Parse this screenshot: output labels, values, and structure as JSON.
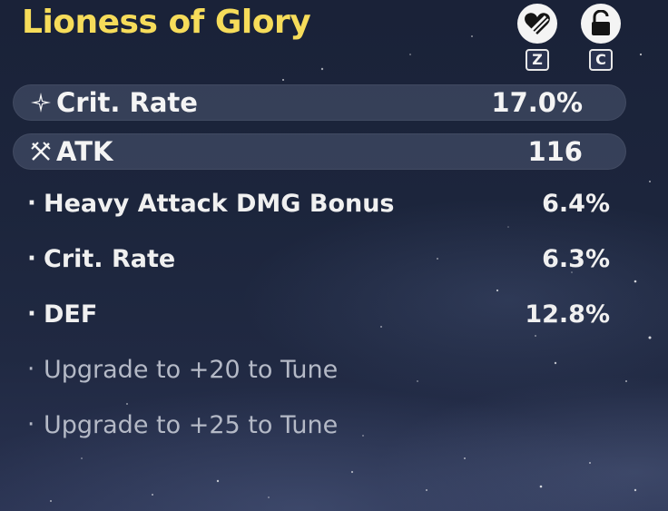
{
  "item": {
    "title": "Lioness of Glory"
  },
  "actions": [
    {
      "icon": "heart-icon",
      "key": "Z"
    },
    {
      "icon": "lock-icon",
      "key": "C"
    }
  ],
  "main_stats": [
    {
      "icon": "crit-star-icon",
      "name": "Crit. Rate",
      "value": "17.0%"
    },
    {
      "icon": "crossed-swords-icon",
      "name": "ATK",
      "value": "116"
    }
  ],
  "sub_stats": [
    {
      "bullet": "·",
      "name": "Heavy Attack DMG Bonus",
      "value": "6.4%"
    },
    {
      "bullet": "·",
      "name": "Crit. Rate",
      "value": "6.3%"
    },
    {
      "bullet": "·",
      "name": "DEF",
      "value": "12.8%"
    }
  ],
  "locked_stats": [
    {
      "bullet": "·",
      "name": "Upgrade to +20 to Tune"
    },
    {
      "bullet": "·",
      "name": "Upgrade to +25 to Tune"
    }
  ],
  "colors": {
    "title": "#f6dc5a",
    "text": "#f4f4f4",
    "locked_text": "#b4b9c6",
    "row_background": "rgba(120,130,160,0.30)"
  }
}
